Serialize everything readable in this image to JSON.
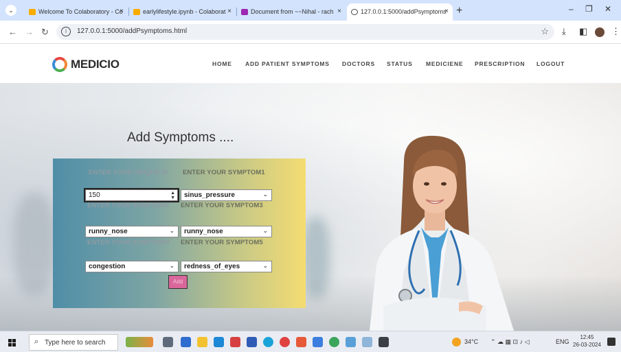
{
  "browser": {
    "tabs": [
      {
        "label": "Welcome To Colaboratory - Co",
        "active": false
      },
      {
        "label": "earlylifestyle.ipynb - Colaborat",
        "active": false
      },
      {
        "label": "Document from ~~Nihal - rach",
        "active": false
      },
      {
        "label": "127.0.0.1:5000/addPsymptoms",
        "active": true
      }
    ],
    "url": "127.0.0.1:5000/addPsymptoms.html"
  },
  "site": {
    "logo": "MEDICIO",
    "nav": [
      "HOME",
      "ADD PATIENT SYMPTOMS",
      "DOCTORS",
      "STATUS",
      "MEDICIENE",
      "PRESCRIPTION",
      "LOGOUT"
    ]
  },
  "form": {
    "title": "Add Symptoms ....",
    "labels": {
      "unique_id": "ENTER YOUR UNIQUE ID",
      "symptom1": "ENTER YOUR SYMPTOM1",
      "symptom2": "ENTER YOUR SYMPTOM2",
      "symptom3": "ENTER YOUR SYMPTOM3",
      "symptom4": "ENTER YOUR SYMPTOM4",
      "symptom5": "ENTER YOUR SYMPTOM5"
    },
    "values": {
      "unique_id": "150",
      "symptom1": "sinus_pressure",
      "symptom2": "runny_nose",
      "symptom3": "runny_nose",
      "symptom4": "congestion",
      "symptom5": "redness_of_eyes"
    },
    "submit": "Add"
  },
  "taskbar": {
    "search_placeholder": "Type here to search",
    "temperature": "34°C",
    "language": "ENG",
    "time": "12:45",
    "date": "26-03-2024"
  },
  "colors": {
    "tabstrip": "#d3e3fd",
    "card_gradient_start": "#4f8ea7",
    "card_gradient_end": "#f5dc72",
    "add_button": "#d9679b"
  }
}
